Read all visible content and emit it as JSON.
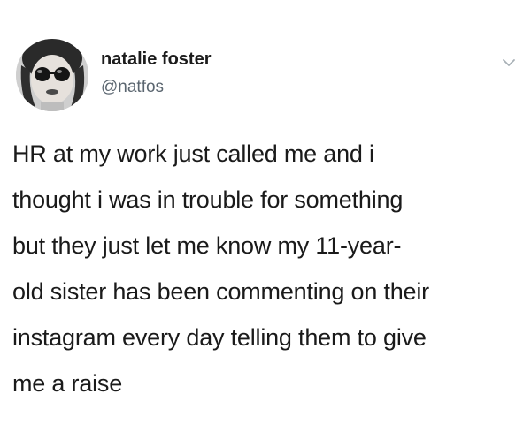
{
  "tweet": {
    "author": {
      "display_name": "natalie foster",
      "handle": "@natfos",
      "avatar_icon": "profile-photo"
    },
    "menu_icon": "chevron-down-icon",
    "text_lines": [
      "HR at my work just called me and i",
      "thought i was in trouble for something",
      "but they just let me know my 11-year-",
      "old sister has been commenting on their",
      "instagram every day telling them to give",
      "me a raise"
    ]
  },
  "colors": {
    "background": "#ffffff",
    "text": "#1a1a1a",
    "handle": "#5b6670",
    "caret": "#a8b0b6"
  }
}
